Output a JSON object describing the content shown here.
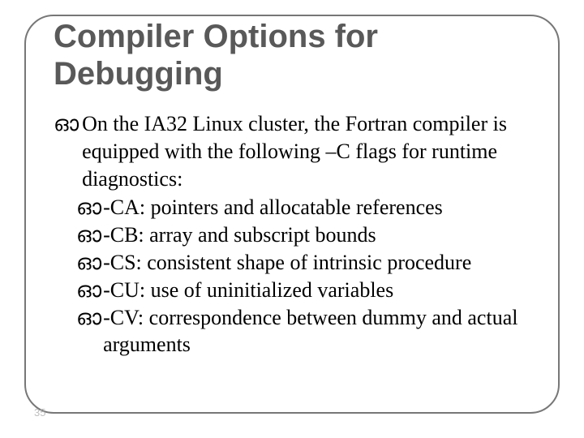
{
  "title": "Compiler Options for Debugging",
  "intro": "On the IA32 Linux cluster, the Fortran compiler is equipped with the following –C flags for runtime diagnostics:",
  "flags": [
    "-CA: pointers and allocatable references",
    "-CB: array and subscript bounds",
    "-CS: consistent shape of intrinsic procedure",
    "-CU: use of uninitialized variables",
    "-CV: correspondence between dummy and actual arguments"
  ],
  "bullet_glyph": "ഓ",
  "page_number": "35"
}
